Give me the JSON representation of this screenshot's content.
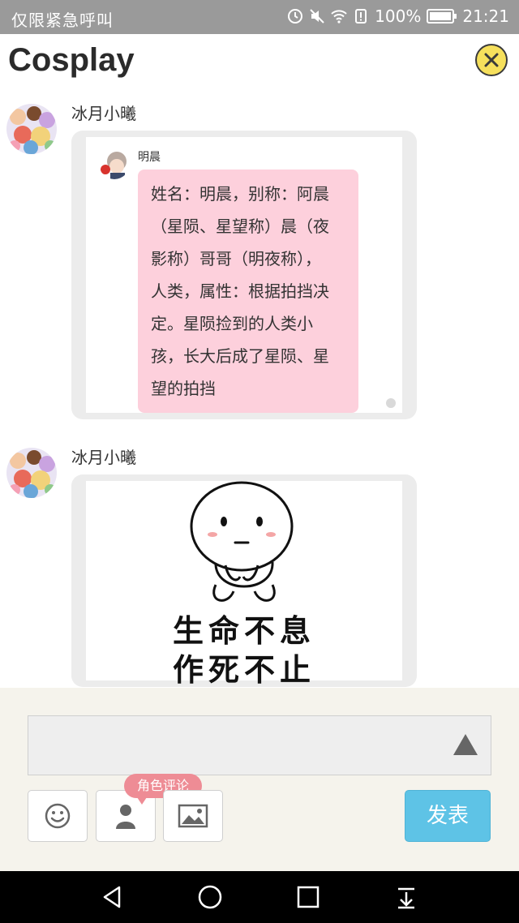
{
  "status_bar": {
    "notice": "仅限紧急呼叫",
    "battery": "100%",
    "time": "21:21"
  },
  "header": {
    "title": "Cosplay"
  },
  "messages": [
    {
      "sender": "冰月小曦",
      "quote": {
        "name": "明晨",
        "lines": [
          "姓名：明晨，别称：阿晨",
          "（星陨、星望称）晨（夜",
          "影称）哥哥（明夜称），",
          "人类，属性：根据拍挡决",
          "定。星陨捡到的人类小",
          "孩，长大后成了星陨、星",
          "望的拍挡"
        ]
      }
    },
    {
      "sender": "冰月小曦",
      "sticker": {
        "line1": "生命不息",
        "line2": "作死不止"
      }
    }
  ],
  "composer": {
    "input_value": "",
    "role_tip": "角色评论",
    "send_label": "发表"
  },
  "colors": {
    "status_bar": "#9a9a9a",
    "close_button": "#f6e05c",
    "quote_bubble": "#fdd0dc",
    "tip": "#ee8c95",
    "send_button": "#5ec3e6",
    "composer_bg": "#f5f3ec"
  },
  "icons": {
    "close": "close-icon",
    "emoji": "smiley-icon",
    "role": "person-icon",
    "image": "image-icon",
    "collapse": "triangle-up-icon",
    "back": "back-icon",
    "home": "home-icon",
    "recents": "recents-icon",
    "notifications": "pull-down-icon"
  }
}
